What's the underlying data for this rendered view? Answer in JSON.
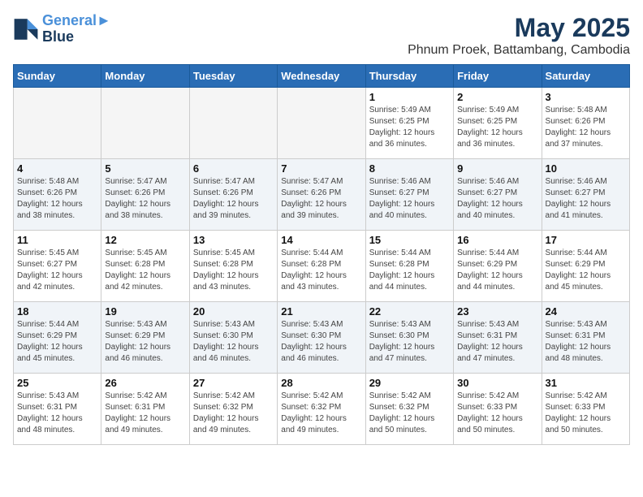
{
  "header": {
    "logo_line1": "General",
    "logo_line2": "Blue",
    "month": "May 2025",
    "location": "Phnum Proek, Battambang, Cambodia"
  },
  "weekdays": [
    "Sunday",
    "Monday",
    "Tuesday",
    "Wednesday",
    "Thursday",
    "Friday",
    "Saturday"
  ],
  "weeks": [
    [
      {
        "day": "",
        "info": ""
      },
      {
        "day": "",
        "info": ""
      },
      {
        "day": "",
        "info": ""
      },
      {
        "day": "",
        "info": ""
      },
      {
        "day": "1",
        "info": "Sunrise: 5:49 AM\nSunset: 6:25 PM\nDaylight: 12 hours\nand 36 minutes."
      },
      {
        "day": "2",
        "info": "Sunrise: 5:49 AM\nSunset: 6:25 PM\nDaylight: 12 hours\nand 36 minutes."
      },
      {
        "day": "3",
        "info": "Sunrise: 5:48 AM\nSunset: 6:26 PM\nDaylight: 12 hours\nand 37 minutes."
      }
    ],
    [
      {
        "day": "4",
        "info": "Sunrise: 5:48 AM\nSunset: 6:26 PM\nDaylight: 12 hours\nand 38 minutes."
      },
      {
        "day": "5",
        "info": "Sunrise: 5:47 AM\nSunset: 6:26 PM\nDaylight: 12 hours\nand 38 minutes."
      },
      {
        "day": "6",
        "info": "Sunrise: 5:47 AM\nSunset: 6:26 PM\nDaylight: 12 hours\nand 39 minutes."
      },
      {
        "day": "7",
        "info": "Sunrise: 5:47 AM\nSunset: 6:26 PM\nDaylight: 12 hours\nand 39 minutes."
      },
      {
        "day": "8",
        "info": "Sunrise: 5:46 AM\nSunset: 6:27 PM\nDaylight: 12 hours\nand 40 minutes."
      },
      {
        "day": "9",
        "info": "Sunrise: 5:46 AM\nSunset: 6:27 PM\nDaylight: 12 hours\nand 40 minutes."
      },
      {
        "day": "10",
        "info": "Sunrise: 5:46 AM\nSunset: 6:27 PM\nDaylight: 12 hours\nand 41 minutes."
      }
    ],
    [
      {
        "day": "11",
        "info": "Sunrise: 5:45 AM\nSunset: 6:27 PM\nDaylight: 12 hours\nand 42 minutes."
      },
      {
        "day": "12",
        "info": "Sunrise: 5:45 AM\nSunset: 6:28 PM\nDaylight: 12 hours\nand 42 minutes."
      },
      {
        "day": "13",
        "info": "Sunrise: 5:45 AM\nSunset: 6:28 PM\nDaylight: 12 hours\nand 43 minutes."
      },
      {
        "day": "14",
        "info": "Sunrise: 5:44 AM\nSunset: 6:28 PM\nDaylight: 12 hours\nand 43 minutes."
      },
      {
        "day": "15",
        "info": "Sunrise: 5:44 AM\nSunset: 6:28 PM\nDaylight: 12 hours\nand 44 minutes."
      },
      {
        "day": "16",
        "info": "Sunrise: 5:44 AM\nSunset: 6:29 PM\nDaylight: 12 hours\nand 44 minutes."
      },
      {
        "day": "17",
        "info": "Sunrise: 5:44 AM\nSunset: 6:29 PM\nDaylight: 12 hours\nand 45 minutes."
      }
    ],
    [
      {
        "day": "18",
        "info": "Sunrise: 5:44 AM\nSunset: 6:29 PM\nDaylight: 12 hours\nand 45 minutes."
      },
      {
        "day": "19",
        "info": "Sunrise: 5:43 AM\nSunset: 6:29 PM\nDaylight: 12 hours\nand 46 minutes."
      },
      {
        "day": "20",
        "info": "Sunrise: 5:43 AM\nSunset: 6:30 PM\nDaylight: 12 hours\nand 46 minutes."
      },
      {
        "day": "21",
        "info": "Sunrise: 5:43 AM\nSunset: 6:30 PM\nDaylight: 12 hours\nand 46 minutes."
      },
      {
        "day": "22",
        "info": "Sunrise: 5:43 AM\nSunset: 6:30 PM\nDaylight: 12 hours\nand 47 minutes."
      },
      {
        "day": "23",
        "info": "Sunrise: 5:43 AM\nSunset: 6:31 PM\nDaylight: 12 hours\nand 47 minutes."
      },
      {
        "day": "24",
        "info": "Sunrise: 5:43 AM\nSunset: 6:31 PM\nDaylight: 12 hours\nand 48 minutes."
      }
    ],
    [
      {
        "day": "25",
        "info": "Sunrise: 5:43 AM\nSunset: 6:31 PM\nDaylight: 12 hours\nand 48 minutes."
      },
      {
        "day": "26",
        "info": "Sunrise: 5:42 AM\nSunset: 6:31 PM\nDaylight: 12 hours\nand 49 minutes."
      },
      {
        "day": "27",
        "info": "Sunrise: 5:42 AM\nSunset: 6:32 PM\nDaylight: 12 hours\nand 49 minutes."
      },
      {
        "day": "28",
        "info": "Sunrise: 5:42 AM\nSunset: 6:32 PM\nDaylight: 12 hours\nand 49 minutes."
      },
      {
        "day": "29",
        "info": "Sunrise: 5:42 AM\nSunset: 6:32 PM\nDaylight: 12 hours\nand 50 minutes."
      },
      {
        "day": "30",
        "info": "Sunrise: 5:42 AM\nSunset: 6:33 PM\nDaylight: 12 hours\nand 50 minutes."
      },
      {
        "day": "31",
        "info": "Sunrise: 5:42 AM\nSunset: 6:33 PM\nDaylight: 12 hours\nand 50 minutes."
      }
    ]
  ]
}
